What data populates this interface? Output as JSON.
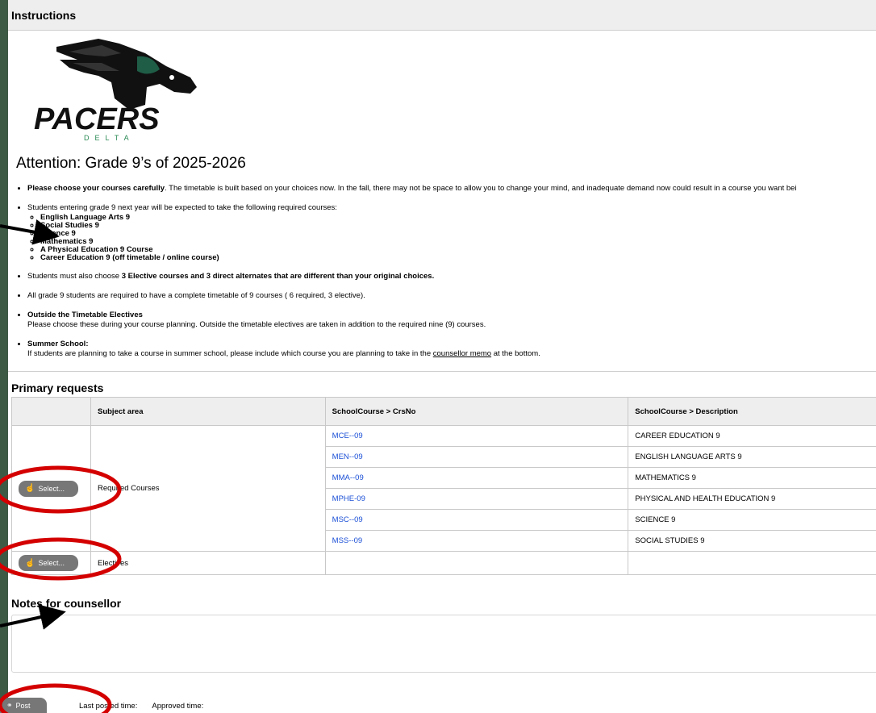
{
  "instructions": {
    "header": "Instructions",
    "logo_text": "PACERS",
    "logo_subtext": "DELTA",
    "attention_title": "Attention: Grade 9’s of 2025-2026",
    "item1_bold": "Please choose your courses carefully",
    "item1_rest": ". The timetable is built based on your choices now.   In the fall, there may not be space to allow you to change your mind, and inadequate demand now could result in a course you want bei",
    "item2_text": "Students entering grade 9 next year will be expected to take the following required courses:",
    "required_courses": [
      "English Language Arts 9",
      "Social Studies 9",
      "Science 9",
      "Mathematics 9",
      "A Physical Education 9 Course",
      "Career Education 9 (off timetable / online course)"
    ],
    "item3_pre": "Students must also choose ",
    "item3_bold": "3 Elective courses and 3 direct alternates that are different than your original choices.",
    "item4_text": "All grade 9 students are required to have a complete timetable of 9 courses ( 6 required, 3 elective).",
    "item5_title": "Outside the Timetable Electives",
    "item5_text": "Please choose these during your course planning.  Outside the timetable electives are taken in addition to the required nine (9) courses.",
    "item6_title": "Summer School:",
    "item6_pre": "If students are planning to take a course in summer school, please include which course you are planning to take in the ",
    "item6_link": "counsellor memo",
    "item6_post": " at the bottom."
  },
  "primary": {
    "title": "Primary requests",
    "columns": [
      "",
      "Subject area",
      "SchoolCourse > CrsNo",
      "SchoolCourse > Description"
    ],
    "select_label": "Select...",
    "required_label": "Required Courses",
    "electives_label": "Electives",
    "courses": [
      {
        "code": "MCE--09",
        "desc": "CAREER EDUCATION 9"
      },
      {
        "code": "MEN--09",
        "desc": "ENGLISH LANGUAGE ARTS 9"
      },
      {
        "code": "MMA--09",
        "desc": "MATHEMATICS 9"
      },
      {
        "code": "MPHE-09",
        "desc": "PHYSICAL AND HEALTH EDUCATION 9"
      },
      {
        "code": "MSC--09",
        "desc": "SCIENCE 9"
      },
      {
        "code": "MSS--09",
        "desc": "SOCIAL STUDIES 9"
      }
    ]
  },
  "notes": {
    "title": "Notes for counsellor",
    "value": ""
  },
  "footer": {
    "post_label": "Post",
    "last_posted_label": "Last posted time:",
    "approved_label": "Approved time:"
  },
  "colors": {
    "link": "#1a4fd6",
    "annotation_red": "#d40000",
    "button_gray": "#777777",
    "side_bg": "#3d5a45"
  }
}
